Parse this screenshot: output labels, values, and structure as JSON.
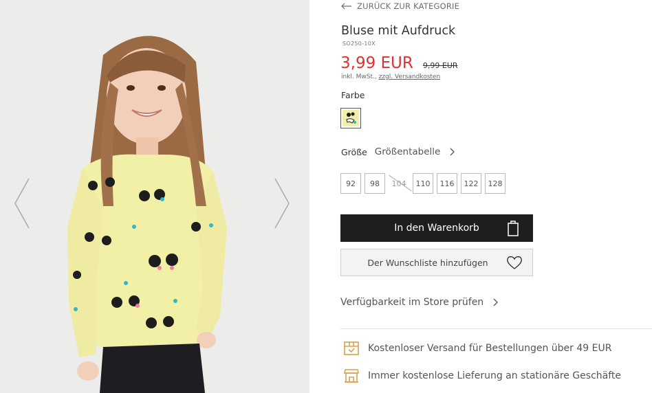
{
  "nav": {
    "back_label": "ZURÜCK ZUR KATEGORIE"
  },
  "product": {
    "title": "Bluse mit Aufdruck",
    "sku": "SO250-10X",
    "price_current": "3,99 EUR",
    "price_old": "9,99 EUR",
    "vat_prefix": "inkl. MwSt.,",
    "shipping_link": "zzgl. Versandkosten"
  },
  "color": {
    "label": "Farbe",
    "selected_swatch_color": "#f2efa6"
  },
  "size": {
    "label": "Größe",
    "chart_label": "Größentabelle",
    "options": [
      "92",
      "98",
      "104",
      "110",
      "116",
      "122",
      "128"
    ],
    "unavailable": [
      "104"
    ]
  },
  "actions": {
    "add_to_cart": "In den Warenkorb",
    "add_to_wishlist": "Der Wunschliste hinzufügen",
    "check_store": "Verfügbarkeit im Store prüfen"
  },
  "features": [
    {
      "icon": "box-icon",
      "text": "Kostenloser Versand für Bestellungen über 49 EUR"
    },
    {
      "icon": "store-icon",
      "text": "Immer kostenlose Lieferung an stationäre Geschäfte"
    }
  ],
  "colors": {
    "accent_price": "#e0312e",
    "button_dark": "#1e1e1e",
    "feature_icon": "#d9a14a"
  }
}
